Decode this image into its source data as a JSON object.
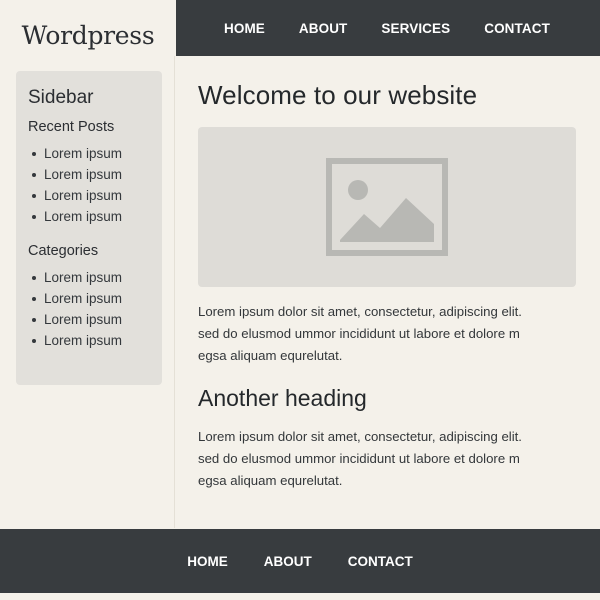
{
  "site": {
    "logo": "Wordpress"
  },
  "header": {
    "nav": [
      "HOME",
      "ABOUT",
      "SERVICES",
      "CONTACT"
    ]
  },
  "sidebar": {
    "title": "Sidebar",
    "recent_posts": {
      "heading": "Recent Posts",
      "items": [
        "Lorem ipsum",
        "Lorem ipsum",
        "Lorem ipsum",
        "Lorem ipsum"
      ]
    },
    "categories": {
      "heading": "Categories",
      "items": [
        "Lorem ipsum",
        "Lorem ipsum",
        "Lorem ipsum",
        "Lorem ipsum"
      ]
    }
  },
  "main": {
    "title": "Welcome to our website",
    "image_icon": "image-placeholder-icon",
    "paragraph1": "Lorem ipsum dolor sit amet, consectetur, adipiscing elit.\nsed do elusmod ummor incididunt ut labore et  dolore m\negsa aliquam equrelutat.",
    "heading2": "Another heading",
    "paragraph2": "Lorem ipsum dolor sit amet, consectetur, adipiscing elit.\nsed do elusmod ummor incididunt ut labore et  dolore m\negsa aliquam equrelutat."
  },
  "footer": {
    "nav": [
      "HOME",
      "ABOUT",
      "CONTACT"
    ]
  },
  "colors": {
    "dark_bar": "#383c3f",
    "page_bg": "#f4f1ea",
    "panel_bg": "#e2e0db",
    "placeholder_icon": "#b8b8b4"
  }
}
